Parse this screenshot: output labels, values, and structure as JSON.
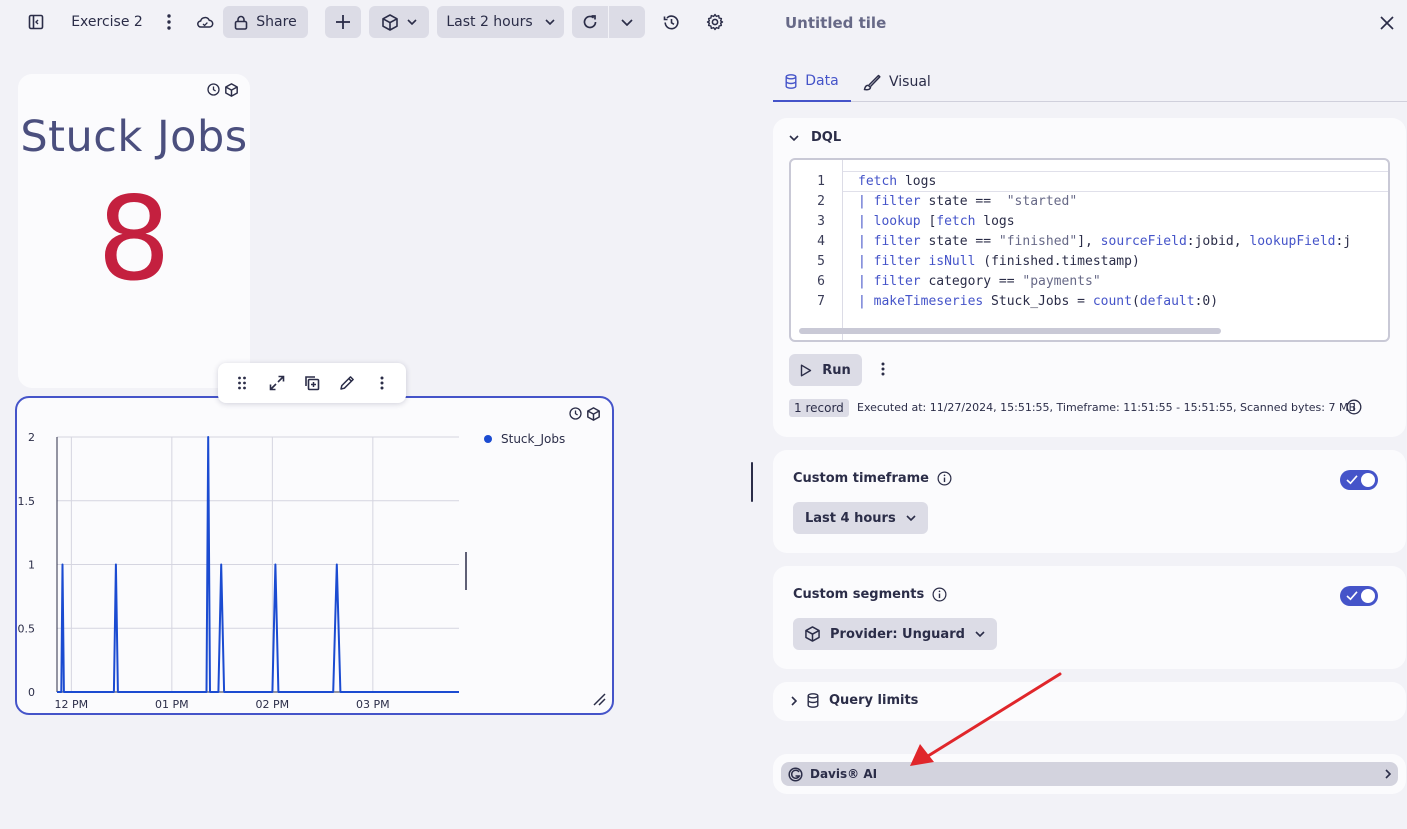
{
  "toolbar": {
    "dashboard_name": "Exercise 2",
    "share_label": "Share",
    "timeframe_label": "Last 2 hours"
  },
  "tiles": {
    "stuck_jobs": {
      "title": "Stuck Jobs",
      "value": "8"
    },
    "chart": {
      "legend": "Stuck_Jobs"
    }
  },
  "chart_data": {
    "type": "line",
    "series": [
      {
        "name": "Stuck_Jobs",
        "color": "#1b4bd1",
        "points": [
          [
            0.0,
            0
          ],
          [
            0.3,
            0
          ],
          [
            0.38,
            1
          ],
          [
            0.48,
            0
          ],
          [
            3.96,
            0
          ],
          [
            4.1,
            1
          ],
          [
            4.24,
            0
          ],
          [
            10.41,
            0
          ],
          [
            10.53,
            2
          ],
          [
            10.66,
            0
          ],
          [
            11.24,
            0
          ],
          [
            11.44,
            1
          ],
          [
            11.64,
            0
          ],
          [
            15.0,
            0
          ],
          [
            15.21,
            1
          ],
          [
            15.42,
            0
          ],
          [
            19.24,
            0
          ],
          [
            19.49,
            1
          ],
          [
            19.74,
            0
          ],
          [
            28.0,
            0
          ]
        ]
      }
    ],
    "x_ticks": [
      {
        "label": "12 PM",
        "value": 1.0
      },
      {
        "label": "01 PM",
        "value": 8.0
      },
      {
        "label": "02 PM",
        "value": 15.0
      },
      {
        "label": "03 PM",
        "value": 22.0
      }
    ],
    "y_ticks": [
      "0",
      "0.5",
      "1",
      "1.5",
      "2"
    ],
    "ylim": [
      0,
      2
    ],
    "grid": true
  },
  "panel": {
    "title": "Untitled tile",
    "tabs": [
      {
        "label": "Data"
      },
      {
        "label": "Visual"
      }
    ],
    "dql": {
      "header": "DQL",
      "line_numbers": [
        "1",
        "2",
        "3",
        "4",
        "5",
        "6",
        "7"
      ],
      "lines": [
        "fetch logs",
        "| filter state ==  \"started\"",
        "| lookup [fetch logs",
        "| filter state == \"finished\"], sourceField:jobid, lookupField:j",
        "| filter isNull (finished.timestamp)",
        "| filter category == \"payments\"",
        "| makeTimeseries Stuck_Jobs = count(default:0)"
      ],
      "run_label": "Run",
      "record_badge": "1 record",
      "exec_info": "Executed at: 11/27/2024, 15:51:55, Timeframe: 11:51:55 - 15:51:55, Scanned bytes: 7 MB"
    },
    "custom_timeframe": {
      "label": "Custom timeframe",
      "value": "Last 4 hours",
      "enabled": true
    },
    "custom_segments": {
      "label": "Custom segments",
      "value": "Provider: Unguard",
      "enabled": true
    },
    "query_limits": {
      "label": "Query limits"
    },
    "davis": {
      "label": "Davis® AI"
    }
  },
  "colors": {
    "accent": "#4554c9",
    "value_red": "#c4203f",
    "annotation_arrow": "#e0262b"
  }
}
